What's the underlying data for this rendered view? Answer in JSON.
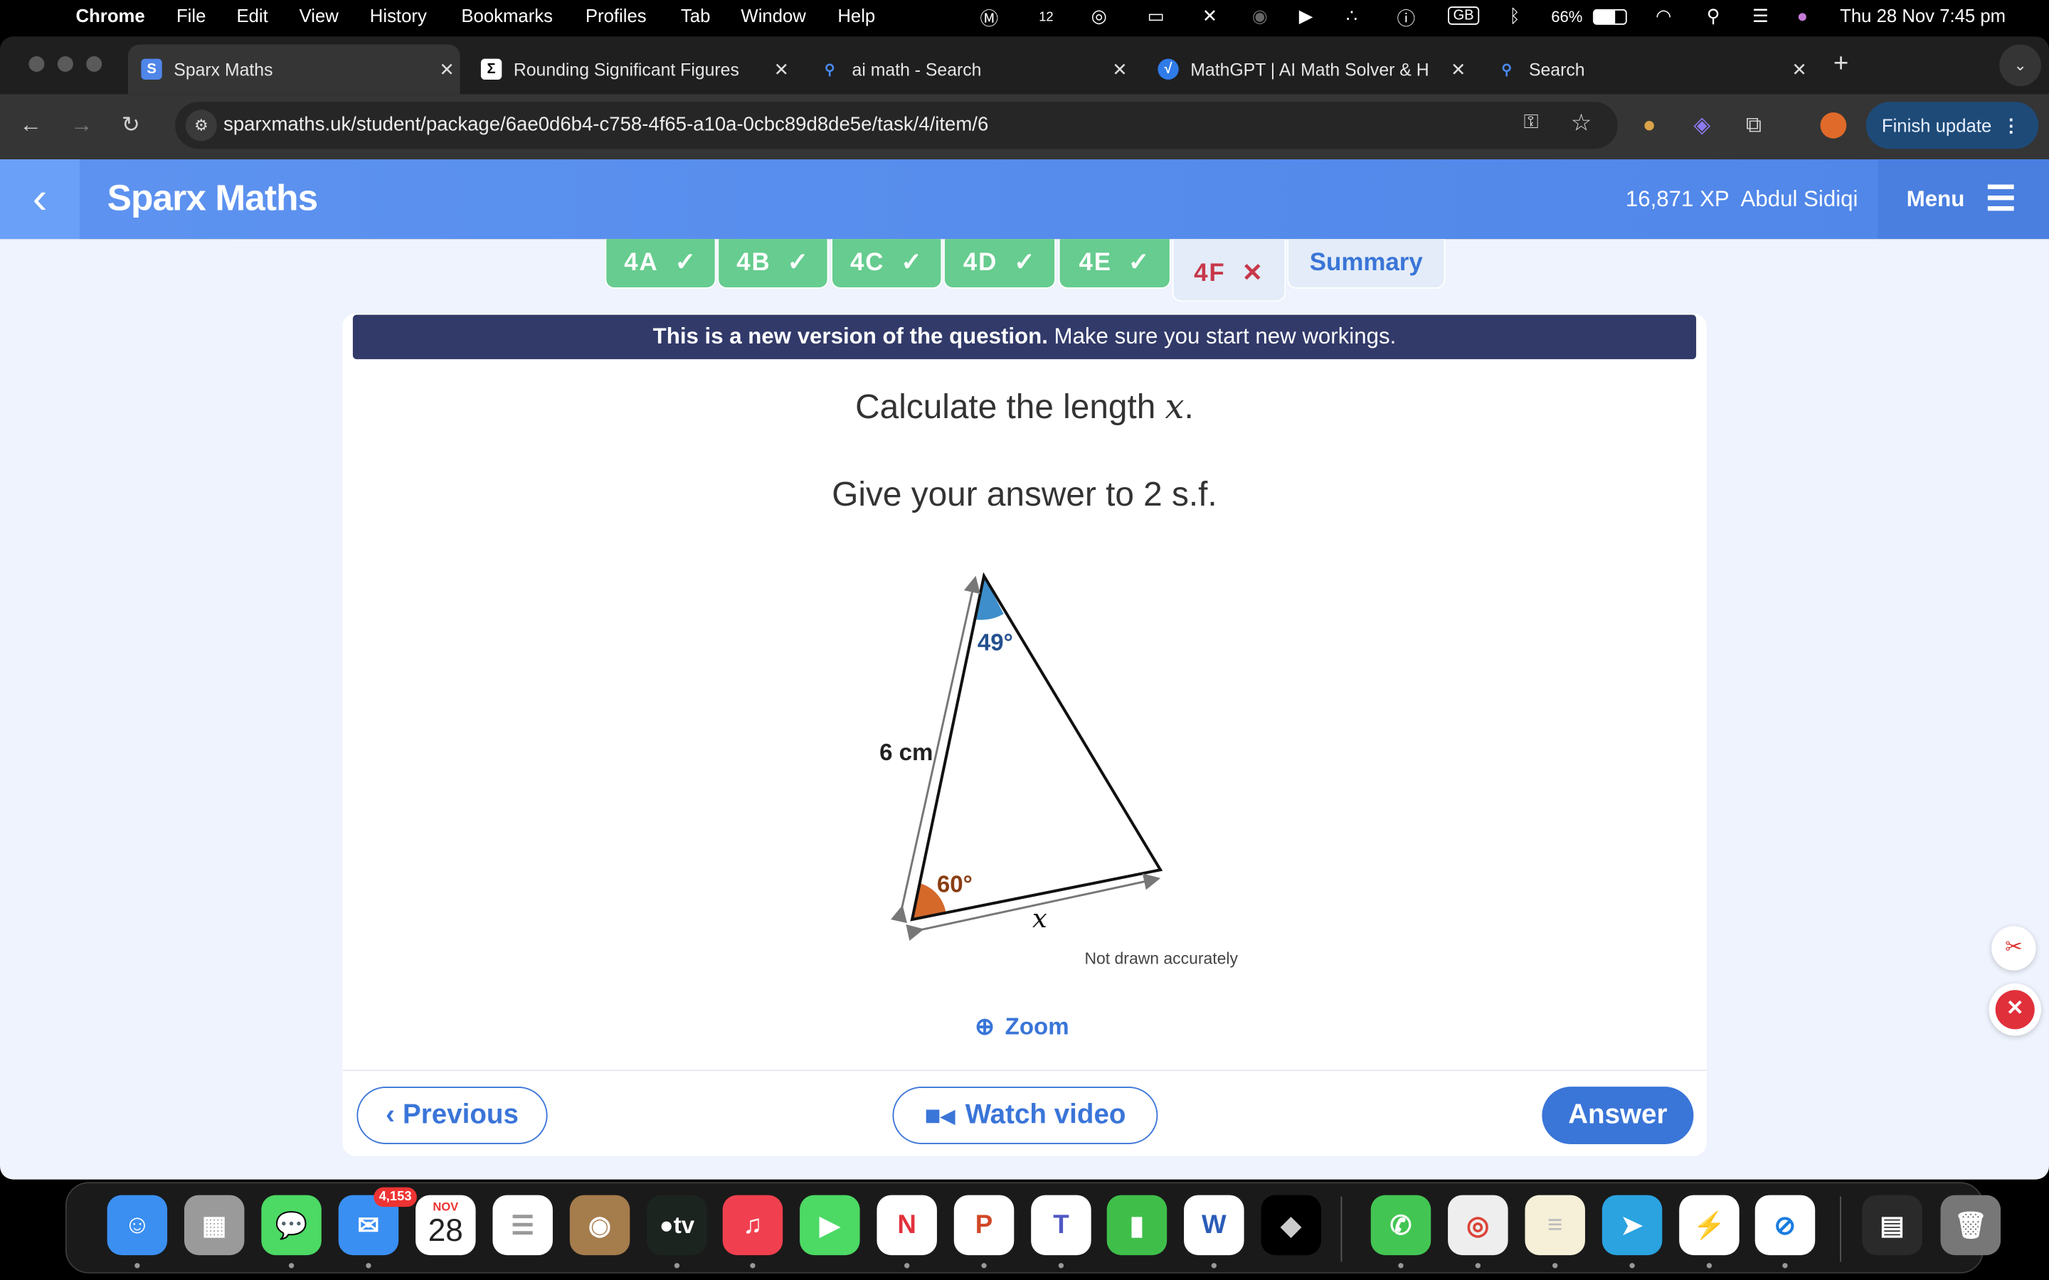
{
  "menubar": {
    "app": "Chrome",
    "items": [
      "File",
      "Edit",
      "View",
      "History",
      "Bookmarks",
      "Profiles",
      "Tab",
      "Window",
      "Help"
    ],
    "status": {
      "notif_count": "12",
      "keyboard": "GB",
      "battery": "66%",
      "battery_level": 66,
      "datetime": "Thu 28 Nov  7:45 pm"
    }
  },
  "browser": {
    "tabs": [
      {
        "title": "Sparx Maths",
        "favicon": "S",
        "active": true
      },
      {
        "title": "Rounding Significant Figures",
        "favicon": "Σ"
      },
      {
        "title": "ai math - Search",
        "favicon": "search-icon"
      },
      {
        "title": "MathGPT | AI Math Solver & H",
        "favicon": "√"
      },
      {
        "title": "Search",
        "favicon": "search-icon"
      }
    ],
    "url": "sparxmaths.uk/student/package/6ae0d6b4-c758-4f65-a10a-0cbc89d8de5e/task/4/item/6",
    "finish_update": "Finish update"
  },
  "sparx": {
    "title": "Sparx Maths",
    "xp": "16,871 XP",
    "user": "Abdul Sidiqi",
    "menu": "Menu",
    "colors": {
      "header": "#5b8ff0",
      "done": "#66cc8f",
      "wrong": "#c8374a",
      "banner": "#323a6a",
      "accent": "#3a75d8"
    },
    "task_tabs": [
      {
        "label": "4A",
        "status": "done",
        "mark": "✓"
      },
      {
        "label": "4B",
        "status": "done",
        "mark": "✓"
      },
      {
        "label": "4C",
        "status": "done",
        "mark": "✓"
      },
      {
        "label": "4D",
        "status": "done",
        "mark": "✓"
      },
      {
        "label": "4E",
        "status": "done",
        "mark": "✓"
      },
      {
        "label": "4F",
        "status": "wrong",
        "mark": "✕"
      },
      {
        "label": "Summary",
        "status": "summary"
      }
    ],
    "banner_bold": "This is a new version of the question.",
    "banner_rest": " Make sure you start new workings.",
    "question_line1_pre": "Calculate the length ",
    "question_var": "x",
    "question_line1_post": ".",
    "question_line2": "Give your answer to 2 s.f.",
    "diagram": {
      "angle_top": "49°",
      "angle_bottom": "60°",
      "side": "6 cm",
      "unknown": "x",
      "note": "Not drawn accurately"
    },
    "zoom": "Zoom",
    "previous": "Previous",
    "watch_video": "Watch video",
    "answer": "Answer"
  },
  "dock": {
    "mail_badge": "4,153",
    "calendar_month": "NOV",
    "calendar_day": "28",
    "tv_label": "tv",
    "apps": [
      "finder",
      "launchpad",
      "messages",
      "mail",
      "calendar",
      "reminders",
      "contacts",
      "apple-tv",
      "music",
      "facetime",
      "news",
      "powerpoint",
      "teams",
      "numbers",
      "word",
      "roblox",
      "whatsapp",
      "chrome",
      "notes",
      "telegram",
      "messenger",
      "safari",
      "document-window",
      "trash"
    ]
  }
}
